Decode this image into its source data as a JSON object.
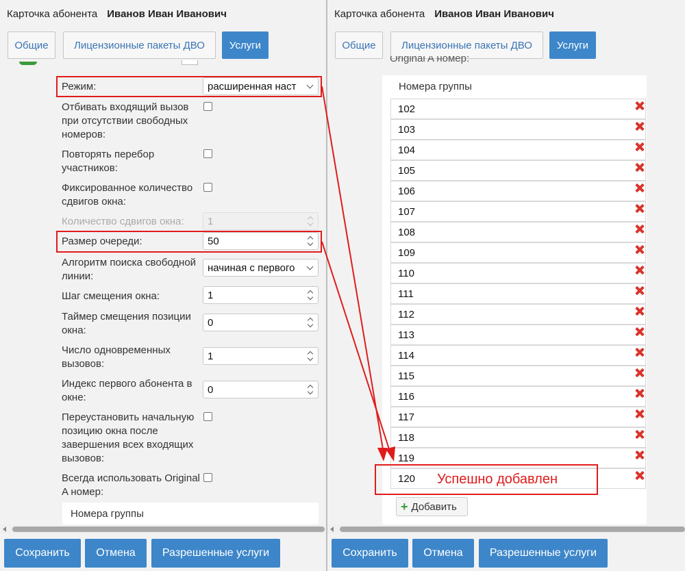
{
  "card": {
    "title": "Карточка абонента",
    "subscriber": "Иванов Иван Иванович"
  },
  "tabs": [
    {
      "label": "Общие"
    },
    {
      "label": "Лицензионные пакеты ДВО"
    },
    {
      "label": "Услуги"
    }
  ],
  "form": {
    "mode_label": "Режим:",
    "mode_value": "расширенная наст",
    "reject_label": "Отбивать входящий вызов при отсутствии свободных номеров:",
    "repeat_label": "Повторять перебор участников:",
    "fixed_label": "Фиксированное количество сдвигов окна:",
    "shifts_label": "Количество сдвигов окна:",
    "shifts_value": "1",
    "queue_label": "Размер очереди:",
    "queue_value": "50",
    "algo_label": "Алгоритм поиска свободной линии:",
    "algo_value": "начиная с первого",
    "step_label": "Шаг смещения окна:",
    "step_value": "1",
    "timer_label": "Таймер смещения позиции окна:",
    "timer_value": "0",
    "simul_label": "Число одновременных вызовов:",
    "simul_value": "1",
    "index_label": "Индекс первого абонента в окне:",
    "index_value": "0",
    "reset_label": "Переустановить начальную позицию окна после завершения всех входящих вызовов:",
    "always_label": "Всегда использовать Original A номер:",
    "group_header": "Номера группы"
  },
  "right": {
    "cut_label": "Original A номер:",
    "group_header": "Номера группы",
    "numbers": [
      "102",
      "103",
      "104",
      "105",
      "106",
      "107",
      "108",
      "109",
      "110",
      "111",
      "112",
      "113",
      "114",
      "115",
      "116",
      "117",
      "118",
      "119",
      "120"
    ],
    "add_label": "Добавить",
    "success_text": "Успешно добавлен"
  },
  "footer": {
    "save": "Сохранить",
    "cancel": "Отмена",
    "allowed": "Разрешенные услуги"
  },
  "colors": {
    "primary": "#3d86c9",
    "annotation_red": "#e01b1b",
    "delete_red": "#d9342b"
  }
}
